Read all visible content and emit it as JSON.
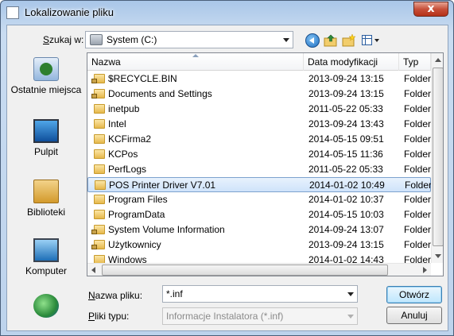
{
  "window": {
    "title": "Lokalizowanie pliku",
    "close_glyph": "x"
  },
  "toolbar": {
    "look_in_label": "Szukaj w:",
    "look_in_value": "System (C:)",
    "icons": [
      "back-icon",
      "up-folder-icon",
      "new-folder-icon",
      "views-menu-icon"
    ]
  },
  "places": [
    {
      "label": "Ostatnie miejsca",
      "icon": "recent-places-icon"
    },
    {
      "label": "Pulpit",
      "icon": "desktop-icon"
    },
    {
      "label": "Biblioteki",
      "icon": "libraries-icon"
    },
    {
      "label": "Komputer",
      "icon": "computer-icon"
    },
    {
      "label": "",
      "icon": "network-icon"
    }
  ],
  "list": {
    "columns": {
      "name": "Nazwa",
      "date": "Data modyfikacji",
      "type": "Typ"
    },
    "rows": [
      {
        "name": "$RECYCLE.BIN",
        "date": "2013-09-24 13:15",
        "type": "Folder",
        "locked": true
      },
      {
        "name": "Documents and Settings",
        "date": "2013-09-24 13:15",
        "type": "Folder",
        "locked": true
      },
      {
        "name": "inetpub",
        "date": "2011-05-22 05:33",
        "type": "Folder",
        "locked": false
      },
      {
        "name": "Intel",
        "date": "2013-09-24 13:43",
        "type": "Folder",
        "locked": false
      },
      {
        "name": "KCFirma2",
        "date": "2014-05-15 09:51",
        "type": "Folder",
        "locked": false
      },
      {
        "name": "KCPos",
        "date": "2014-05-15 11:36",
        "type": "Folder",
        "locked": false
      },
      {
        "name": "PerfLogs",
        "date": "2011-05-22 05:33",
        "type": "Folder",
        "locked": false
      },
      {
        "name": "POS Printer Driver V7.01",
        "date": "2014-01-02 10:49",
        "type": "Folder",
        "locked": false,
        "selected": true
      },
      {
        "name": "Program Files",
        "date": "2014-01-02 10:37",
        "type": "Folder",
        "locked": false
      },
      {
        "name": "ProgramData",
        "date": "2014-05-15 10:03",
        "type": "Folder",
        "locked": false
      },
      {
        "name": "System Volume Information",
        "date": "2014-09-24 13:07",
        "type": "Folder",
        "locked": true
      },
      {
        "name": "Użytkownicy",
        "date": "2013-09-24 13:15",
        "type": "Folder",
        "locked": true
      },
      {
        "name": "Windows",
        "date": "2014-01-02 14:43",
        "type": "Folder",
        "locked": false
      }
    ]
  },
  "filename": {
    "label_prefix": "N",
    "label_rest": "azwa pliku:",
    "value": "*.inf"
  },
  "filetype": {
    "label_prefix": "P",
    "label_rest": "liki typu:",
    "value": "Informacje Instalatora (*.inf)"
  },
  "buttons": {
    "open": "Otwórz",
    "cancel": "Anuluj"
  },
  "colors": {
    "selection": "#cfe3fa",
    "default_button": "#bee6fd",
    "close_button": "#c7503a"
  }
}
